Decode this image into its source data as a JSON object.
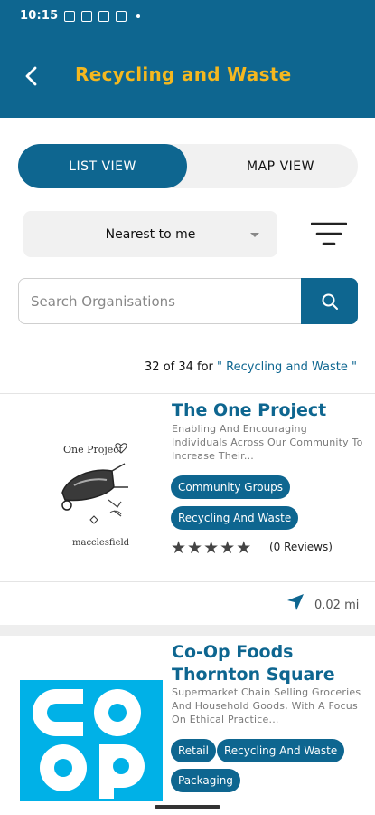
{
  "status_bar": {
    "time": "10:15"
  },
  "header": {
    "title": "Recycling and Waste"
  },
  "view_toggle": {
    "list_label": "LIST VIEW",
    "map_label": "MAP VIEW",
    "selected": "LIST VIEW"
  },
  "sort": {
    "selected": "Nearest to me"
  },
  "search": {
    "placeholder": "Search Organisations"
  },
  "results": {
    "summary": "32 of 34 for",
    "query": "\" Recycling and Waste \""
  },
  "organisations": [
    {
      "name": "The One Project",
      "description": "Enabling And Encouraging Individuals Across Our Community To Increase Their...",
      "tags": [
        "Community Groups",
        "Recycling And Waste"
      ],
      "rating": 5,
      "reviews": "(0 Reviews)",
      "distance": "0.02 mi",
      "logo_text_top": "One Project",
      "logo_text_bottom": "macclesfield"
    },
    {
      "name_line1": "Co-Op Foods",
      "name_line2": "Thornton Square",
      "description": "Supermarket Chain Selling Groceries And Household Goods, With A Focus On Ethical Practice...",
      "tags": [
        "Retail",
        "Recycling And Waste",
        "Packaging"
      ],
      "logo_text": "coop"
    }
  ],
  "colors": {
    "primary": "#0e6690",
    "accent": "#f4b81f",
    "coop_blue": "#00b1e7"
  }
}
